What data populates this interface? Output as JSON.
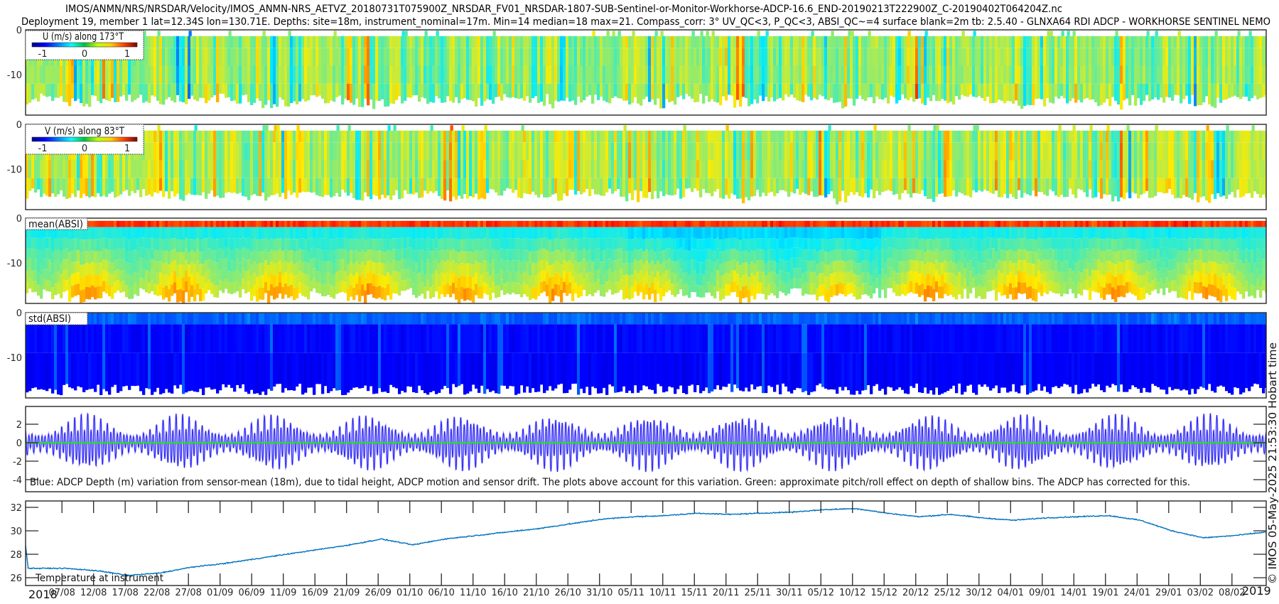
{
  "title": {
    "line1": "IMOS/ANMN/NRS/NRSDAR/Velocity/IMOS_ANMN-NRS_AETVZ_20180731T075900Z_NRSDAR_FV01_NRSDAR-1807-SUB-Sentinel-or-Monitor-Workhorse-ADCP-16.6_END-20190213T222900Z_C-20190402T064204Z.nc",
    "line2": "Deployment 19, member 1 lat=12.34S lon=130.71E. Depths: site=18m, instrument_nominal=17m. Min=14 median=18 max=21. Compass_corr: 3° UV_QC<3, P_QC<3, ABSI_QC~=4 surface blank=2m tb: 2.5.40 - GLNXA64 RDI ADCP - WORKHORSE SENTINEL NEMO"
  },
  "credit": "© IMOS 05-May-2025 21:53:30 Hobart time",
  "xaxis": {
    "year_start": "2018",
    "year_end": "2019",
    "xlim": [
      "2018-08-01T06:00",
      "2019-02-13T10:00"
    ],
    "ticks": [
      "07/08",
      "12/08",
      "17/08",
      "22/08",
      "27/08",
      "01/09",
      "06/09",
      "11/09",
      "16/09",
      "21/09",
      "26/09",
      "01/10",
      "06/10",
      "11/10",
      "16/10",
      "21/10",
      "26/10",
      "31/10",
      "05/11",
      "10/11",
      "15/11",
      "20/11",
      "25/11",
      "30/11",
      "05/12",
      "10/12",
      "15/12",
      "20/12",
      "25/12",
      "30/12",
      "04/01",
      "09/01",
      "14/01",
      "19/01",
      "24/01",
      "29/01",
      "03/02",
      "08/02"
    ]
  },
  "chart_data": [
    {
      "type": "heatmap",
      "colorbar_label": "U (m/s) along 173°T",
      "colormap": "jet",
      "clim": [
        -1.25,
        1.25
      ],
      "colorbar_ticks": [
        "-1",
        "0",
        "1"
      ],
      "yticks": [
        "0",
        "-10"
      ],
      "ylim": [
        -19,
        0
      ],
      "typical_value_range": [
        -0.4,
        0.6
      ]
    },
    {
      "type": "heatmap",
      "colorbar_label": "V (m/s) along 83°T",
      "colormap": "jet",
      "clim": [
        -1.25,
        1.25
      ],
      "colorbar_ticks": [
        "-1",
        "0",
        "1"
      ],
      "yticks": [
        "0",
        "-10"
      ],
      "ylim": [
        -19,
        0
      ],
      "typical_value_range": [
        -0.4,
        0.7
      ]
    },
    {
      "type": "heatmap",
      "label": "mean(ABSI)",
      "colormap": "jet",
      "yticks": [
        "0",
        "-10"
      ],
      "ylim": [
        -19,
        0
      ]
    },
    {
      "type": "heatmap",
      "label": "std(ABSI)",
      "colormap": "jet",
      "yticks": [
        "0",
        "-10"
      ],
      "ylim": [
        -19,
        0
      ]
    },
    {
      "type": "line",
      "caption": "Blue: ADCP Depth (m) variation from sensor-mean (18m), due to tidal height, ADCP motion and sensor drift. The plots above account for this variation. Green: approximate pitch/roll effect on depth of shallow bins. The ADCP has corrected for this.",
      "yticks": [
        "2",
        "0",
        "-2",
        "-4"
      ],
      "ylim": [
        -5.2,
        3.9
      ],
      "series": [
        {
          "color": "#1a1aff",
          "spring_amplitude_m": 3.2,
          "neap_amplitude_m": 1.0,
          "spring_neap_period_days": 14.77
        },
        {
          "color": "#22e022",
          "value": 0
        }
      ]
    },
    {
      "type": "line",
      "label": "Temperature at instrument",
      "yticks": [
        "32",
        "30",
        "28",
        "26"
      ],
      "ylim": [
        25.35,
        32.55
      ],
      "color": "#0072bd",
      "x": [
        "2018-08-01",
        "2018-08-01",
        "2018-08-07",
        "2018-08-12",
        "2018-08-17",
        "2018-08-22",
        "2018-08-27",
        "2018-09-01",
        "2018-09-06",
        "2018-09-11",
        "2018-09-16",
        "2018-09-21",
        "2018-09-26",
        "2018-10-01",
        "2018-10-06",
        "2018-10-11",
        "2018-10-16",
        "2018-10-21",
        "2018-10-26",
        "2018-10-31",
        "2018-11-05",
        "2018-11-10",
        "2018-11-15",
        "2018-11-20",
        "2018-11-25",
        "2018-11-30",
        "2018-12-05",
        "2018-12-10",
        "2018-12-15",
        "2018-12-20",
        "2018-12-25",
        "2018-12-30",
        "2019-01-04",
        "2019-01-09",
        "2019-01-14",
        "2019-01-19",
        "2019-01-24",
        "2019-01-29",
        "2019-02-03",
        "2019-02-08",
        "2019-02-13"
      ],
      "y": [
        28.8,
        26.8,
        26.8,
        26.6,
        26.2,
        26.4,
        26.9,
        27.2,
        27.6,
        28.0,
        28.4,
        28.8,
        29.3,
        28.8,
        29.3,
        29.6,
        29.9,
        30.2,
        30.6,
        31.0,
        31.2,
        31.3,
        31.5,
        31.4,
        31.5,
        31.6,
        31.8,
        31.9,
        31.5,
        31.2,
        31.4,
        31.1,
        30.9,
        31.1,
        31.2,
        31.3,
        30.9,
        30.0,
        29.4,
        29.6,
        29.9
      ]
    }
  ]
}
